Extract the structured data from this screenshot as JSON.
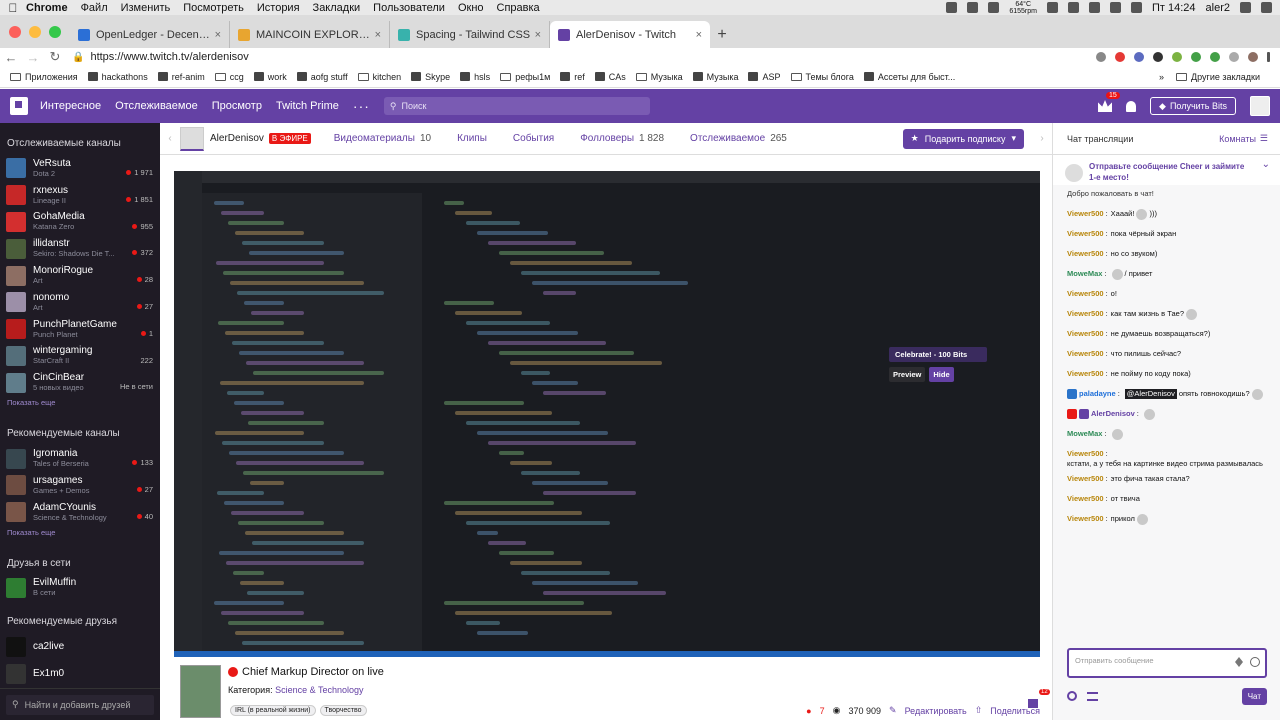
{
  "macmenu": {
    "app": "Chrome",
    "items": [
      "Файл",
      "Изменить",
      "Посмотреть",
      "История",
      "Закладки",
      "Пользователи",
      "Окно",
      "Справка"
    ],
    "weather_temp": "64°C",
    "weather_rpm": "6155rpm",
    "clock": "Пт 14:24",
    "user": "aler2"
  },
  "tabs": [
    {
      "title": "OpenLedger - Decentralized A",
      "color": "#2b6fd6"
    },
    {
      "title": "MAINCOIN EXPLORER",
      "color": "#e8a530"
    },
    {
      "title": "Spacing - Tailwind CSS",
      "color": "#38b2ac"
    },
    {
      "title": "AlerDenisov - Twitch",
      "color": "#6441a4"
    }
  ],
  "address": {
    "url": "https://www.twitch.tv/alerdenisov"
  },
  "bookmarks": [
    "Приложения",
    "hackathons",
    "ref-anim",
    "ccg",
    "work",
    "aofg stuff",
    "kitchen",
    "Skype",
    "hsls",
    "рефы1м",
    "ref",
    "CAs",
    "Музыка",
    "Музыка",
    "ASP",
    "Темы блога",
    "Ассеты для быст..."
  ],
  "bookmarks_other": "Другие закладки",
  "twitch_nav": {
    "links": [
      "Интересное",
      "Отслеживаемое",
      "Просмотр",
      "Twitch Prime"
    ],
    "search_placeholder": "Поиск",
    "crown_badge": "15",
    "bits_label": "Получить Bits"
  },
  "sidebar": {
    "followed_title": "Отслеживаемые каналы",
    "followed": [
      {
        "name": "VeRsuta",
        "game": "Dota 2",
        "viewers": "1 971",
        "live": true,
        "color": "#3a6ea5"
      },
      {
        "name": "rxnexus",
        "game": "Lineage II",
        "viewers": "1 851",
        "live": true,
        "color": "#c62828"
      },
      {
        "name": "GohaMedia",
        "game": "Katana Zero",
        "viewers": "955",
        "live": true,
        "color": "#d32f2f"
      },
      {
        "name": "illidanstr",
        "game": "Sekiro: Shadows Die T...",
        "viewers": "372",
        "live": true,
        "color": "#4a5d3a"
      },
      {
        "name": "MonoriRogue",
        "game": "Art",
        "viewers": "28",
        "live": true,
        "color": "#8d6e63"
      },
      {
        "name": "nonomo",
        "game": "Art",
        "viewers": "27",
        "live": true,
        "color": "#9c8fa8"
      },
      {
        "name": "PunchPlanetGame",
        "game": "Punch Planet",
        "viewers": "1",
        "live": true,
        "color": "#b71c1c"
      },
      {
        "name": "wintergaming",
        "game": "StarCraft II",
        "viewers": "222",
        "live": false,
        "color": "#546e7a"
      },
      {
        "name": "CinCinBear",
        "game": "5 новых видео",
        "viewers": "Не в сети",
        "live": false,
        "color": "#607d8b"
      }
    ],
    "followed_more": "Показать еще",
    "recommended_title": "Рекомендуемые каналы",
    "recommended": [
      {
        "name": "Igromania",
        "game": "Tales of Berseria",
        "viewers": "133",
        "live": true,
        "color": "#37474f"
      },
      {
        "name": "ursagames",
        "game": "Games + Demos",
        "viewers": "27",
        "live": true,
        "color": "#6d4c41"
      },
      {
        "name": "AdamCYounis",
        "game": "Science & Technology",
        "viewers": "40",
        "live": true,
        "color": "#795548"
      }
    ],
    "recommended_more": "Показать еще",
    "friends_title": "Друзья в сети",
    "friends": [
      {
        "name": "EvilMuffin",
        "status": "В сети",
        "color": "#2e7d32"
      }
    ],
    "rec_friends_title": "Рекомендуемые друзья",
    "rec_friends": [
      {
        "name": "ca2live",
        "color": "#111"
      },
      {
        "name": "Ex1m0",
        "color": "#333"
      }
    ],
    "find_friends": "Найти и добавить друзей"
  },
  "channel": {
    "name": "AlerDenisov",
    "live_label": "В ЭФИРЕ",
    "tabs": [
      {
        "label": "Видеоматериалы",
        "count": "10"
      },
      {
        "label": "Клипы",
        "count": ""
      },
      {
        "label": "События",
        "count": ""
      },
      {
        "label": "Фолловеры",
        "count": "1 828"
      },
      {
        "label": "Отслеживаемое",
        "count": "265"
      }
    ],
    "subscribe_label": "Подарить подписку"
  },
  "player": {
    "cheer_label": "Celebrate! - 100 Bits",
    "preview_label": "Preview",
    "hide_label": "Hide"
  },
  "stream_info": {
    "title": "Chief Markup Director on live",
    "category_label": "Категория:",
    "category": "Science & Technology",
    "tags": [
      "IRL (в реальной жизни)",
      "Творчество"
    ],
    "viewers_live": "7",
    "views_total": "370 909",
    "edit_label": "Редактировать",
    "share_label": "Поделиться",
    "feedback_badge": "12"
  },
  "chat": {
    "title": "Чат трансляции",
    "rooms_label": "Комнаты",
    "cheer_banner": "Отправьте сообщение Cheer и займите 1-е место!",
    "welcome": "Добро пожаловать в чат!",
    "messages": [
      {
        "user": "Viewer500",
        "color": "#b8860b",
        "text": "Хааай!",
        "emote": true,
        "after": ")))"
      },
      {
        "user": "Viewer500",
        "color": "#b8860b",
        "text": "пока чёрный экран"
      },
      {
        "user": "Viewer500",
        "color": "#b8860b",
        "text": "но со звуком)"
      },
      {
        "user": "MoweMax",
        "color": "#2e8b57",
        "text": "",
        "emote": true,
        "after": "/ привет"
      },
      {
        "user": "Viewer500",
        "color": "#b8860b",
        "text": "о!"
      },
      {
        "user": "Viewer500",
        "color": "#b8860b",
        "text": "как там жизнь в Тае?",
        "emote": true
      },
      {
        "user": "Viewer500",
        "color": "#b8860b",
        "text": "не думаешь возвращаться?)"
      },
      {
        "user": "Viewer500",
        "color": "#b8860b",
        "text": "что пилишь сейчас?"
      },
      {
        "user": "Viewer500",
        "color": "#b8860b",
        "text": "не пойму по коду пока)"
      },
      {
        "user": "paladayne",
        "color": "#1e6fd9",
        "mention": "@AlerDenisov",
        "text": "опять говнокодишь?",
        "emote": true,
        "badge": "#2a73c9"
      },
      {
        "user": "AlerDenisov",
        "color": "#6441a4",
        "text": "",
        "emote": true,
        "badge": "#e91916",
        "badge2": "#6441a4"
      },
      {
        "user": "MoweMax",
        "color": "#2e8b57",
        "text": "",
        "emote": true
      },
      {
        "user": "Viewer500",
        "color": "#b8860b",
        "text": "кстати, а у тебя на картинке видео стрима размывалась"
      },
      {
        "user": "Viewer500",
        "color": "#b8860b",
        "text": "это фича такая стала?"
      },
      {
        "user": "Viewer500",
        "color": "#b8860b",
        "text": "от твича"
      },
      {
        "user": "Viewer500",
        "color": "#b8860b",
        "text": "прикол",
        "emote": true
      }
    ],
    "input_placeholder": "Отправить сообщение",
    "send_label": "Чат"
  }
}
